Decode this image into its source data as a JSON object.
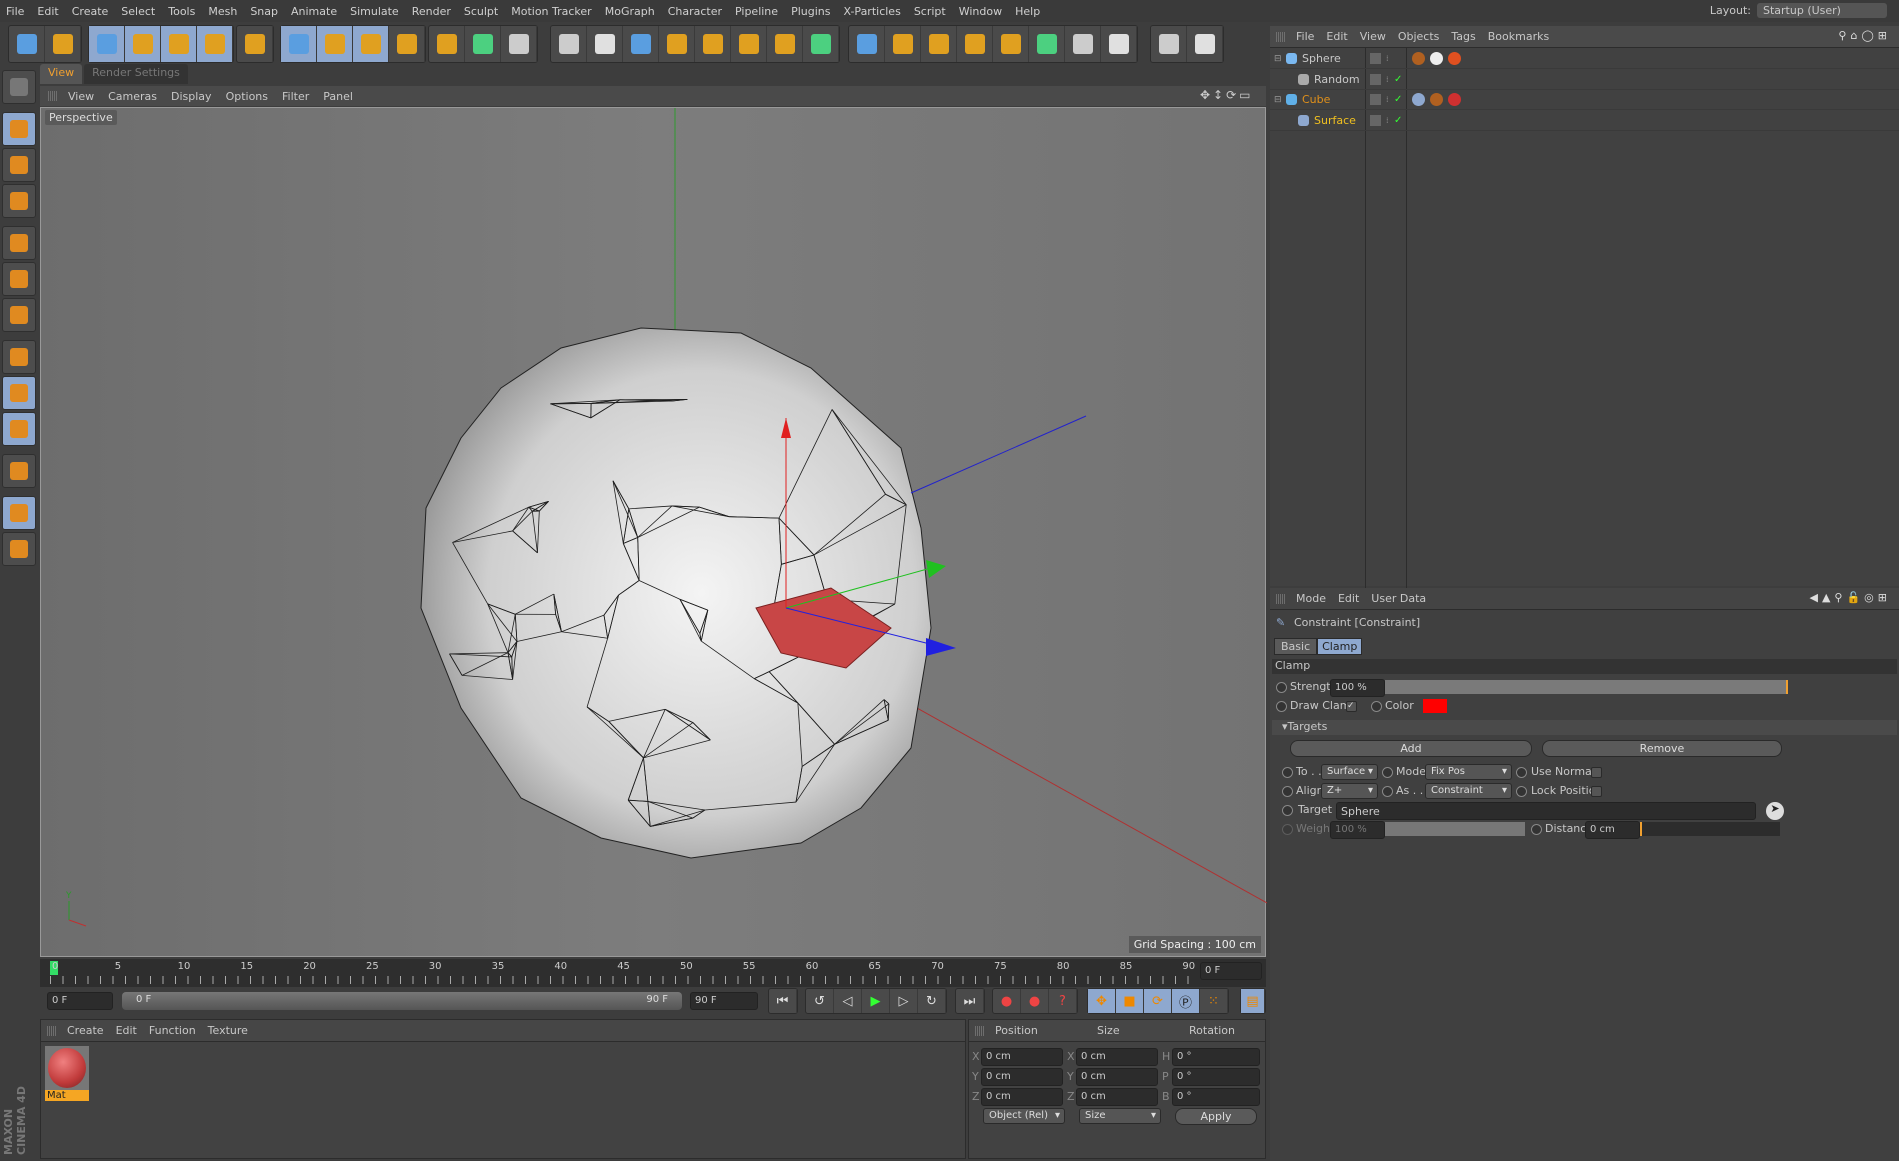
{
  "menu": [
    "File",
    "Edit",
    "Create",
    "Select",
    "Tools",
    "Mesh",
    "Snap",
    "Animate",
    "Simulate",
    "Render",
    "Sculpt",
    "Motion Tracker",
    "MoGraph",
    "Character",
    "Pipeline",
    "Plugins",
    "X-Particles",
    "Script",
    "Window",
    "Help"
  ],
  "layout": {
    "label": "Layout:",
    "value": "Startup (User)"
  },
  "viewport": {
    "tabs": [
      "View",
      "Render Settings"
    ],
    "menu": [
      "View",
      "Cameras",
      "Display",
      "Options",
      "Filter",
      "Panel"
    ],
    "label": "Perspective",
    "grid_spacing": "Grid Spacing : 100 cm"
  },
  "timeline": {
    "ticks": [
      "0",
      "5",
      "10",
      "15",
      "20",
      "25",
      "30",
      "35",
      "40",
      "45",
      "50",
      "55",
      "60",
      "65",
      "70",
      "75",
      "80",
      "85",
      "90"
    ],
    "current_frame": "0 F",
    "start": "0 F",
    "range_start": "0 F",
    "range_end": "90 F",
    "end": "90 F"
  },
  "material_manager": {
    "menu": [
      "Create",
      "Edit",
      "Function",
      "Texture"
    ],
    "materials": [
      {
        "name": "Mat",
        "color": "#d04848"
      }
    ]
  },
  "coordinates": {
    "headers": [
      "Position",
      "Size",
      "Rotation"
    ],
    "rows": [
      {
        "a": "X",
        "p": "0 cm",
        "b": "X",
        "s": "0 cm",
        "c": "H",
        "r": "0 °"
      },
      {
        "a": "Y",
        "p": "0 cm",
        "b": "Y",
        "s": "0 cm",
        "c": "P",
        "r": "0 °"
      },
      {
        "a": "Z",
        "p": "0 cm",
        "b": "Z",
        "s": "0 cm",
        "c": "B",
        "r": "0 °"
      }
    ],
    "mode": "Object (Rel)",
    "size_mode": "Size",
    "apply": "Apply"
  },
  "object_manager": {
    "menu": [
      "File",
      "Edit",
      "View",
      "Objects",
      "Tags",
      "Bookmarks"
    ],
    "objects": [
      {
        "name": "Sphere",
        "color": "#c8c8c8"
      },
      {
        "name": "Random",
        "color": "#c8c8c8"
      },
      {
        "name": "Cube",
        "color": "#e0901a"
      },
      {
        "name": "Surface",
        "color": "#f0c020"
      }
    ]
  },
  "attributes": {
    "menu": [
      "Mode",
      "Edit",
      "User Data"
    ],
    "title": "Constraint [Constraint]",
    "tabs": [
      "Basic",
      "Clamp"
    ],
    "section": "Clamp",
    "strength_label": "Strength",
    "strength": "100 %",
    "strength_fraction": 1.0,
    "draw_clamp_label": "Draw Clamp",
    "draw_clamp": true,
    "color_label": "Color",
    "clamp_color": "#ff0000",
    "targets_label": "Targets",
    "add": "Add",
    "remove": "Remove",
    "to_label": "To . .",
    "to": "Surface",
    "mode_label": "Mode",
    "mode": "Fix Pos",
    "use_normals": "Use Normals",
    "align_label": "Align",
    "align": "Z+",
    "as_label": "As . . .",
    "as": "Constraint",
    "lock_position": "Lock Position",
    "target_label": "Target",
    "target": "Sphere",
    "weight_label": "Weight",
    "weight": "100 %",
    "distance_label": "Distance",
    "distance": "0 cm"
  },
  "brand": "MAXON CINEMA 4D"
}
